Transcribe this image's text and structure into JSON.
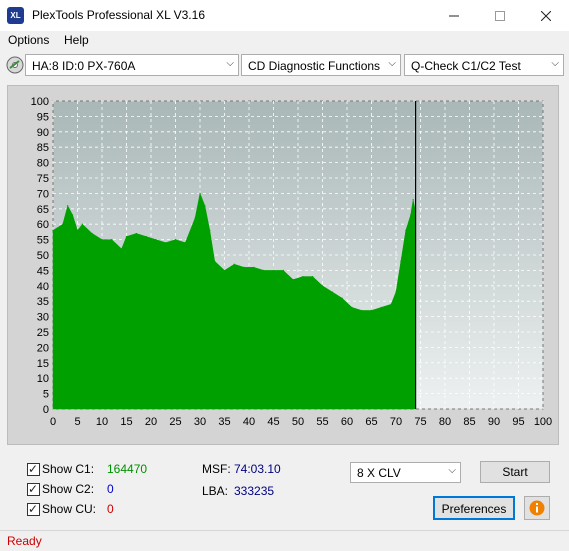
{
  "window": {
    "title": "PlexTools Professional XL V3.16",
    "icon_text": "XL"
  },
  "menu": {
    "items": [
      "Options",
      "Help"
    ]
  },
  "toolbar": {
    "drive": "HA:8 ID:0  PX-760A",
    "function": "CD Diagnostic Functions",
    "test": "Q-Check C1/C2 Test"
  },
  "chart_data": {
    "type": "area",
    "xlim": [
      0,
      100
    ],
    "ylim": [
      0,
      100
    ],
    "x_ticks": [
      0,
      5,
      10,
      15,
      20,
      25,
      30,
      35,
      40,
      45,
      50,
      55,
      60,
      65,
      70,
      75,
      80,
      85,
      90,
      95,
      100
    ],
    "y_ticks": [
      0,
      5,
      10,
      15,
      20,
      25,
      30,
      35,
      40,
      45,
      50,
      55,
      60,
      65,
      70,
      75,
      80,
      85,
      90,
      95,
      100
    ],
    "marker_x": 74,
    "series": [
      {
        "color": "#00a000",
        "x": [
          0,
          2,
          3,
          4,
          5,
          6,
          8,
          10,
          12,
          14,
          15,
          17,
          19,
          21,
          23,
          25,
          27,
          29,
          30,
          31,
          32,
          33,
          35,
          37,
          39,
          41,
          43,
          45,
          47,
          49,
          51,
          53,
          55,
          57,
          59,
          61,
          63,
          65,
          67,
          69,
          70,
          71,
          72,
          73,
          73.5,
          74
        ],
        "values": [
          58,
          60,
          66,
          63,
          58,
          60,
          57,
          55,
          55,
          52,
          56,
          57,
          56,
          55,
          54,
          55,
          54,
          62,
          70,
          66,
          58,
          48,
          45,
          47,
          46,
          46,
          45,
          45,
          45,
          42,
          43,
          43,
          40,
          38,
          36,
          33,
          32,
          32,
          33,
          34,
          38,
          48,
          58,
          63,
          68,
          64
        ]
      }
    ]
  },
  "bottom": {
    "c1": {
      "label": "Show C1:",
      "value": "164470"
    },
    "c2": {
      "label": "Show C2:",
      "value": "0"
    },
    "cu": {
      "label": "Show CU:",
      "value": "0"
    },
    "msf": {
      "label": "MSF:",
      "value": "74:03.10"
    },
    "lba": {
      "label": "LBA:",
      "value": "333235"
    },
    "speed": "8 X CLV",
    "start_label": "Start",
    "preferences_label": "Preferences"
  },
  "status": "Ready"
}
